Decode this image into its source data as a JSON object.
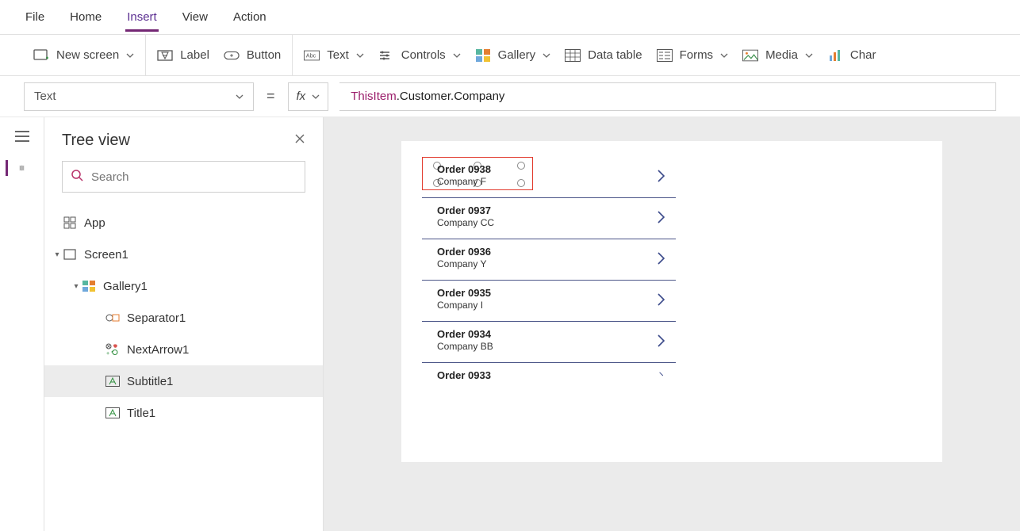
{
  "menu": {
    "items": [
      "File",
      "Home",
      "Insert",
      "View",
      "Action"
    ],
    "active": 2
  },
  "ribbon": {
    "new_screen": "New screen",
    "label": "Label",
    "button": "Button",
    "text": "Text",
    "controls": "Controls",
    "gallery": "Gallery",
    "data_table": "Data table",
    "forms": "Forms",
    "media": "Media",
    "charts": "Char"
  },
  "formula": {
    "property": "Text",
    "fx": "fx",
    "token_this": "ThisItem",
    "token_rest": ".Customer.Company"
  },
  "tree": {
    "title": "Tree view",
    "search_placeholder": "Search",
    "app": "App",
    "screen": "Screen1",
    "gallery": "Gallery1",
    "separator": "Separator1",
    "nextarrow": "NextArrow1",
    "subtitle": "Subtitle1",
    "title1": "Title1"
  },
  "canvas": {
    "items": [
      {
        "title": "Order 0938",
        "sub": "Company F"
      },
      {
        "title": "Order 0937",
        "sub": "Company CC"
      },
      {
        "title": "Order 0936",
        "sub": "Company Y"
      },
      {
        "title": "Order 0935",
        "sub": "Company I"
      },
      {
        "title": "Order 0934",
        "sub": "Company BB"
      },
      {
        "title": "Order 0933",
        "sub": ""
      }
    ]
  }
}
